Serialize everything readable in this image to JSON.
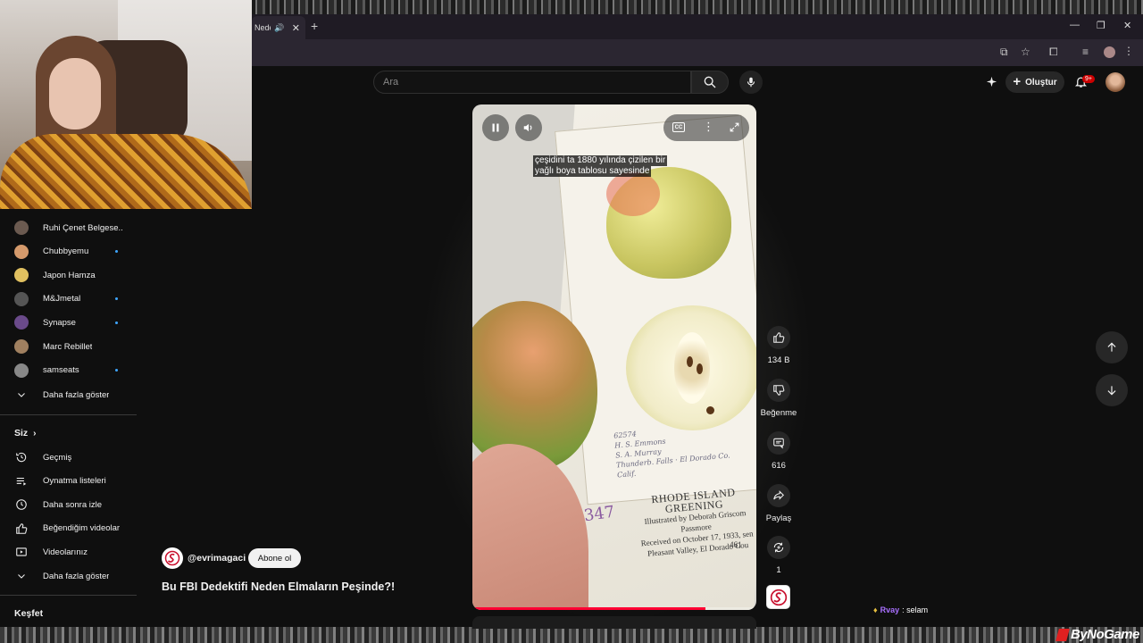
{
  "browser": {
    "tab_title": "Nede",
    "new_tab_icon": "plus-icon"
  },
  "header": {
    "search_placeholder": "Ara",
    "create_label": "Oluştur",
    "notification_count": "9+"
  },
  "sidebar": {
    "subscriptions": [
      {
        "label": "Ruhi Çenet Belgese...",
        "new": false,
        "color": "#6b5a50"
      },
      {
        "label": "Chubbyemu",
        "new": true,
        "color": "#d59a6c"
      },
      {
        "label": "Japon Hamza",
        "new": false,
        "color": "#e0c060"
      },
      {
        "label": "M&Jmetal",
        "new": true,
        "color": "#555555"
      },
      {
        "label": "Synapse",
        "new": true,
        "color": "#6a4a8a"
      },
      {
        "label": "Marc Rebillet",
        "new": false,
        "color": "#a08060"
      },
      {
        "label": "samseats",
        "new": true,
        "color": "#888888"
      }
    ],
    "show_more_1": "Daha fazla göster",
    "you_section": "Siz",
    "you_items": [
      {
        "label": "Geçmiş",
        "icon": "history-icon"
      },
      {
        "label": "Oynatma listeleri",
        "icon": "playlist-icon"
      },
      {
        "label": "Daha sonra izle",
        "icon": "clock-icon"
      },
      {
        "label": "Beğendiğim videolar",
        "icon": "thumbs-up-icon"
      },
      {
        "label": "Videolarınız",
        "icon": "video-icon"
      }
    ],
    "show_more_2": "Daha fazla göster",
    "explore_section": "Keşfet"
  },
  "short": {
    "caption_line1": "çeşidini ta 1880 yılında çizilen bir",
    "caption_line2": "yağlı boya tablosu sayesinde",
    "progress": 0.82,
    "plate": {
      "handwriting": [
        "62574",
        "H. S. Emmons",
        "S. A. Murray",
        "Thunderb. Falls · El Dorado Co.",
        "Calif."
      ],
      "title": "RHODE ISLAND GREENING",
      "lines": [
        "Illustrated by Deborah Griscom Passmore",
        "Received on October 17, 1933, sen",
        "Pleasant Valley, El Dorado Cou"
      ],
      "page_number": "461",
      "pencil_number": "347"
    },
    "channel": "@evrimagaci",
    "subscribe_label": "Abone ol",
    "title": "Bu FBI Dedektifi Neden Elmaların Peşinde?!"
  },
  "actions": {
    "likes": "134 B",
    "dislike_label": "Beğenme",
    "comments": "616",
    "share_label": "Paylaş",
    "remix_count": "1"
  },
  "stream": {
    "chat_user": "Rvay",
    "chat_message": ": selam",
    "watermark": "ByNoGame"
  },
  "colors": {
    "accent_red": "#ff0033",
    "background": "#0f0f0f",
    "new_dot": "#3ea6ff"
  }
}
